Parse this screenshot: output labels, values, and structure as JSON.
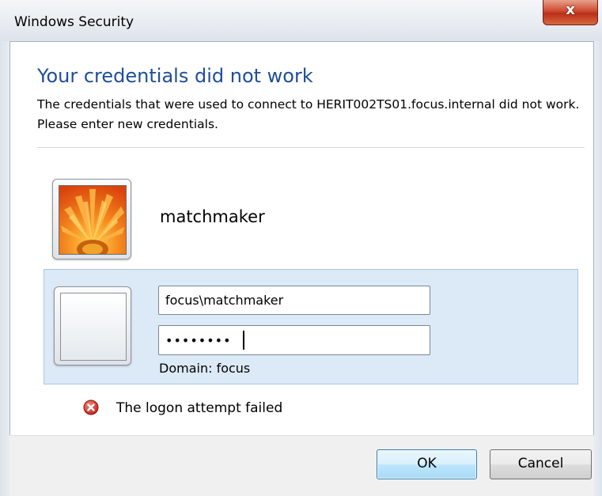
{
  "window": {
    "title": "Windows Security",
    "close_label": "x"
  },
  "dialog": {
    "heading": "Your credentials did not work",
    "description": "The credentials that were used to connect to HERIT002TS01.focus.internal did not work. Please enter new credentials."
  },
  "account": {
    "username": "matchmaker",
    "avatar_icon": "flower-avatar-icon"
  },
  "credentials": {
    "username_value": "focus\\matchmaker",
    "password_masked": "••••••••",
    "domain_text": "Domain: focus",
    "blank_tile_icon": "blank-user-tile-icon"
  },
  "error": {
    "icon": "error-x-icon",
    "message": "The logon attempt failed"
  },
  "buttons": {
    "ok_label": "OK",
    "cancel_label": "Cancel"
  },
  "colors": {
    "heading": "#1e4e9c",
    "panel_bg": "#dce9f7",
    "close_button": "#c9452c",
    "error_icon": "#d22a2a"
  }
}
